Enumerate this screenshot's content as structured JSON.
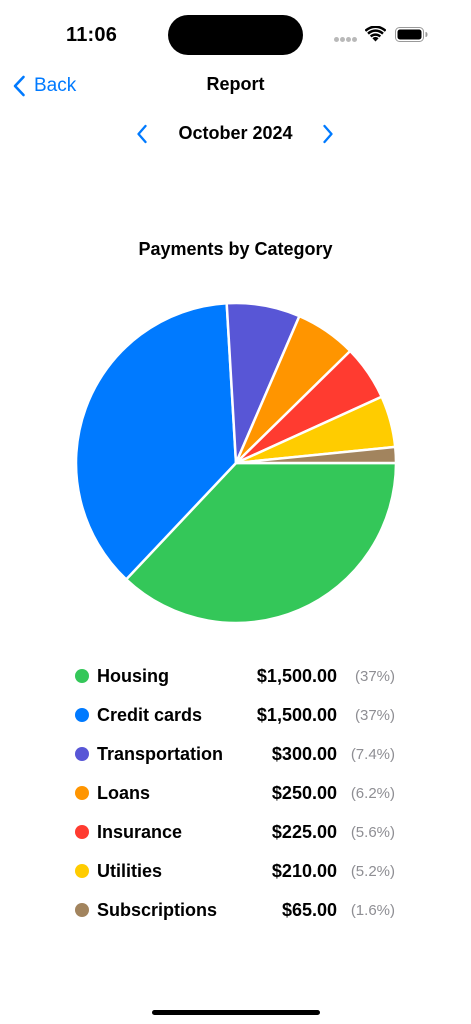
{
  "status_bar": {
    "time": "11:06"
  },
  "nav": {
    "back_label": "Back",
    "title": "Report"
  },
  "month_selector": {
    "label": "October 2024",
    "prev_icon": "chevron-left-icon",
    "next_icon": "chevron-right-icon"
  },
  "colors": {
    "accent": "#007aff",
    "secondary_text": "#8e8e93"
  },
  "chart_data": {
    "type": "pie",
    "title": "Payments by Category",
    "categories": [
      "Housing",
      "Credit cards",
      "Transportation",
      "Loans",
      "Insurance",
      "Utilities",
      "Subscriptions"
    ],
    "values": [
      1500,
      1500,
      300,
      250,
      225,
      210,
      65
    ],
    "colors": [
      "#34c759",
      "#007aff",
      "#5856d6",
      "#ff9500",
      "#ff3b30",
      "#ffcc00",
      "#a2845e"
    ],
    "start_angle_deg": 0,
    "direction": "clockwise"
  },
  "legend": [
    {
      "name": "Housing",
      "amount": "$1,500.00",
      "percent": "(37%)",
      "color": "#34c759"
    },
    {
      "name": "Credit cards",
      "amount": "$1,500.00",
      "percent": "(37%)",
      "color": "#007aff"
    },
    {
      "name": "Transportation",
      "amount": "$300.00",
      "percent": "(7.4%)",
      "color": "#5856d6"
    },
    {
      "name": "Loans",
      "amount": "$250.00",
      "percent": "(6.2%)",
      "color": "#ff9500"
    },
    {
      "name": "Insurance",
      "amount": "$225.00",
      "percent": "(5.6%)",
      "color": "#ff3b30"
    },
    {
      "name": "Utilities",
      "amount": "$210.00",
      "percent": "(5.2%)",
      "color": "#ffcc00"
    },
    {
      "name": "Subscriptions",
      "amount": "$65.00",
      "percent": "(1.6%)",
      "color": "#a2845e"
    }
  ]
}
